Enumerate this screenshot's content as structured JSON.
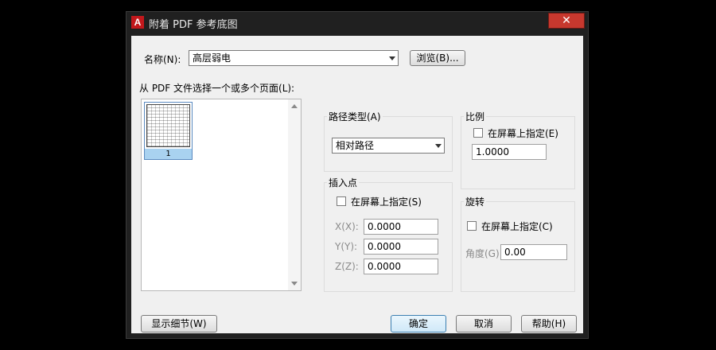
{
  "window": {
    "title": "附着 PDF 参考底图",
    "app_icon_letter": "A",
    "close_glyph": "✕"
  },
  "name_row": {
    "label": "名称(N):",
    "selected": "高层弱电",
    "browse_label": "浏览(B)..."
  },
  "pages": {
    "label": "从 PDF 文件选择一个或多个页面(L):",
    "items": [
      {
        "label": "1",
        "selected": true
      }
    ]
  },
  "path_type": {
    "label": "路径类型(A)",
    "selected": "相对路径"
  },
  "scale": {
    "label": "比例",
    "specify_on_screen": "在屏幕上指定(E)",
    "checked": false,
    "value": "1.0000"
  },
  "insertion": {
    "label": "插入点",
    "specify_on_screen": "在屏幕上指定(S)",
    "checked": false,
    "x_label": "X(X):",
    "x_value": "0.0000",
    "y_label": "Y(Y):",
    "y_value": "0.0000",
    "z_label": "Z(Z):",
    "z_value": "0.0000"
  },
  "rotation": {
    "label": "旋转",
    "specify_on_screen": "在屏幕上指定(C)",
    "checked": false,
    "angle_label": "角度(G):",
    "angle_value": "0.00"
  },
  "footer": {
    "details_label": "显示细节(W)",
    "ok_label": "确定",
    "cancel_label": "取消",
    "help_label": "帮助(H)"
  },
  "colors": {
    "window_frame": "#202020",
    "client_bg": "#f0f0f0",
    "close_button": "#c7382e",
    "selection": "#a9d2f0"
  }
}
